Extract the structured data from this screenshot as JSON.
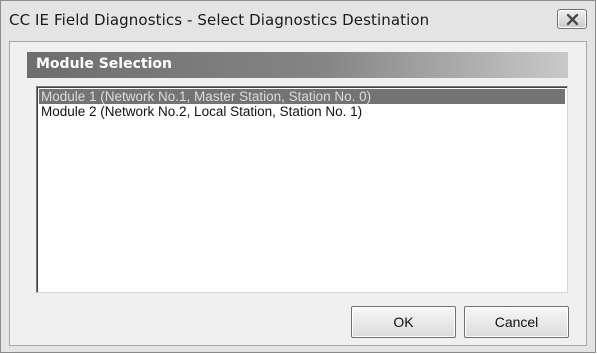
{
  "window": {
    "title": "CC IE Field Diagnostics - Select Diagnostics Destination"
  },
  "section": {
    "header": "Module Selection"
  },
  "module_list": {
    "items": [
      {
        "label": "Module 1 (Network No.1, Master Station, Station No. 0)",
        "selected": true
      },
      {
        "label": "Module 2 (Network No.2, Local Station, Station No. 1)",
        "selected": false
      }
    ]
  },
  "buttons": {
    "ok_label": "OK",
    "cancel_label": "Cancel"
  },
  "icons": {
    "close": "close-icon"
  },
  "colors": {
    "window_background": "#e4e4e4",
    "header_gradient_start": "#6e6e6e",
    "header_gradient_end": "#c9c9c9",
    "selection_background": "#737373",
    "selection_text": "#dcdcdc"
  }
}
